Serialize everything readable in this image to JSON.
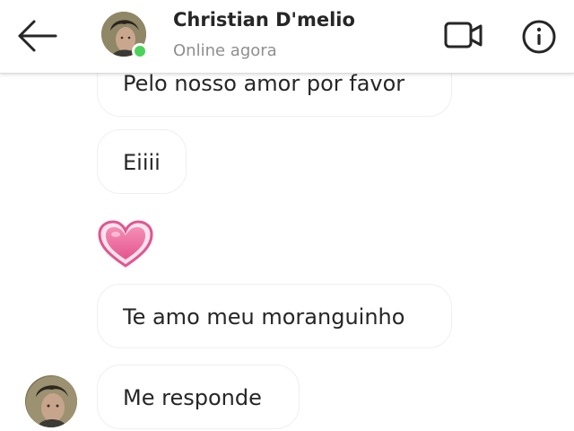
{
  "header": {
    "contact_name": "Christian D'melio",
    "status": "Online agora",
    "back_icon": "arrow-left-icon",
    "video_call_icon": "video-camera-icon",
    "info_icon": "info-icon",
    "online_color": "#4bd25c"
  },
  "messages": [
    {
      "type": "text",
      "text": "Pelo nosso amor por favor"
    },
    {
      "type": "text",
      "text": "Eiiii"
    },
    {
      "type": "emoji",
      "icon": "pink-heart-icon",
      "color": "#e8679a"
    },
    {
      "type": "text",
      "text": "Te amo meu moranguinho"
    },
    {
      "type": "text",
      "text": "Me responde"
    }
  ]
}
